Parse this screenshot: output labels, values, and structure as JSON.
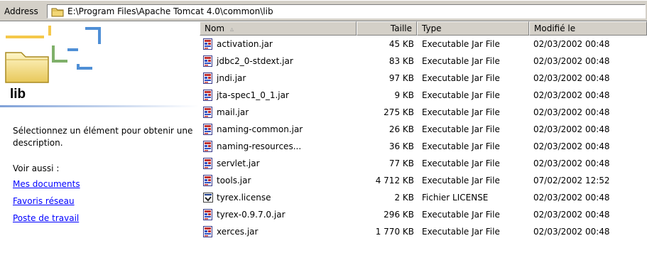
{
  "address": {
    "label": "Address",
    "path": "E:\\Program Files\\Apache Tomcat 4.0\\common\\lib"
  },
  "left_panel": {
    "folder_name": "lib",
    "description": "Sélectionnez un élément pour obtenir une description.",
    "see_also_label": "Voir aussi :",
    "links": [
      "Mes documents",
      "Favoris réseau",
      "Poste de travail"
    ]
  },
  "columns": {
    "name": "Nom",
    "size": "Taille",
    "type": "Type",
    "modified": "Modifié le"
  },
  "sort_indicator": "▵",
  "files": [
    {
      "name": "activation.jar",
      "size": "45 KB",
      "type": "Executable Jar File",
      "modified": "02/03/2002 00:48",
      "icon": "jar-file-icon"
    },
    {
      "name": "jdbc2_0-stdext.jar",
      "size": "83 KB",
      "type": "Executable Jar File",
      "modified": "02/03/2002 00:48",
      "icon": "jar-file-icon"
    },
    {
      "name": "jndi.jar",
      "size": "97 KB",
      "type": "Executable Jar File",
      "modified": "02/03/2002 00:48",
      "icon": "jar-file-icon"
    },
    {
      "name": "jta-spec1_0_1.jar",
      "size": "9 KB",
      "type": "Executable Jar File",
      "modified": "02/03/2002 00:48",
      "icon": "jar-file-icon"
    },
    {
      "name": "mail.jar",
      "size": "275 KB",
      "type": "Executable Jar File",
      "modified": "02/03/2002 00:48",
      "icon": "jar-file-icon"
    },
    {
      "name": "naming-common.jar",
      "size": "26 KB",
      "type": "Executable Jar File",
      "modified": "02/03/2002 00:48",
      "icon": "jar-file-icon"
    },
    {
      "name": "naming-resources...",
      "size": "36 KB",
      "type": "Executable Jar File",
      "modified": "02/03/2002 00:48",
      "icon": "jar-file-icon"
    },
    {
      "name": "servlet.jar",
      "size": "77 KB",
      "type": "Executable Jar File",
      "modified": "02/03/2002 00:48",
      "icon": "jar-file-icon"
    },
    {
      "name": "tools.jar",
      "size": "4 712 KB",
      "type": "Executable Jar File",
      "modified": "07/02/2002 12:52",
      "icon": "jar-file-icon"
    },
    {
      "name": "tyrex.license",
      "size": "2 KB",
      "type": "Fichier LICENSE",
      "modified": "02/03/2002 00:48",
      "icon": "license-file-icon"
    },
    {
      "name": "tyrex-0.9.7.0.jar",
      "size": "296 KB",
      "type": "Executable Jar File",
      "modified": "02/03/2002 00:48",
      "icon": "jar-file-icon"
    },
    {
      "name": "xerces.jar",
      "size": "1 770 KB",
      "type": "Executable Jar File",
      "modified": "02/03/2002 00:48",
      "icon": "jar-file-icon"
    }
  ]
}
